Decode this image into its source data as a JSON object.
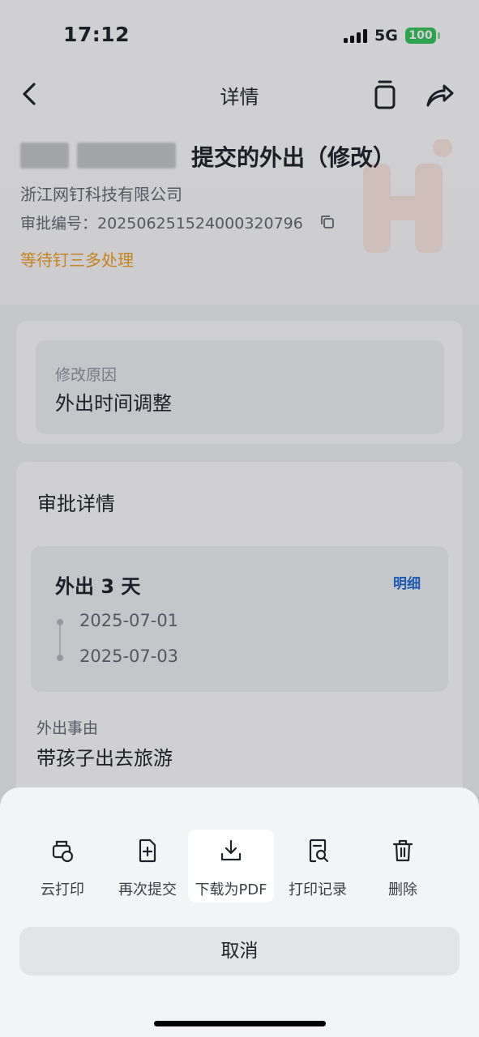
{
  "status_bar": {
    "time": "17:12",
    "network": "5G",
    "battery": "100"
  },
  "nav": {
    "title": "详情",
    "icons": [
      "back-icon",
      "copy-icon",
      "share-icon"
    ]
  },
  "header": {
    "title": "提交的外出（修改）",
    "company": "浙江网钉科技有限公司",
    "approval_no": "审批编号：20250625152400032079​6",
    "status": "等待钉三多处理"
  },
  "modify_reason": {
    "label": "修改原因",
    "value": "外出时间调整"
  },
  "approval_details": {
    "section_title": "审批详情",
    "out_summary": "外出 3 天",
    "detail_link": "明细",
    "start_date": "2025-07-01",
    "end_date": "2025-07-03",
    "reason_label": "外出事由",
    "reason_value": "带孩子出去旅游"
  },
  "action_sheet": {
    "actions": [
      {
        "label": "云打印",
        "icon": "cloud-print-icon"
      },
      {
        "label": "再次提交",
        "icon": "resubmit-icon"
      },
      {
        "label": "下载为PDF",
        "icon": "download-icon"
      },
      {
        "label": "打印记录",
        "icon": "print-record-icon"
      },
      {
        "label": "删除",
        "icon": "trash-icon"
      }
    ],
    "cancel_label": "取消"
  },
  "colors": {
    "pending": "#f0a020",
    "link": "#1f6bd6",
    "battery": "#34c759"
  }
}
